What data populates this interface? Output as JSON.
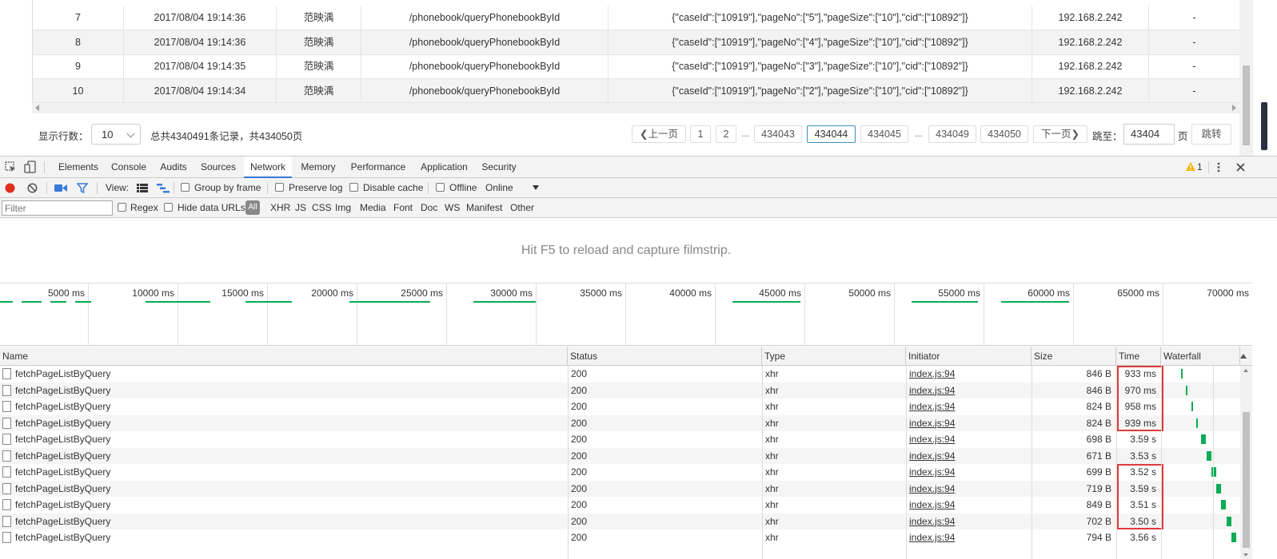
{
  "grid": {
    "rows": [
      {
        "no": "7",
        "time": "2017/08/04 19:14:36",
        "user": "范映渪",
        "url": "/phonebook/queryPhonebookById",
        "params": "{\"caseId\":[\"10919\"],\"pageNo\":[\"5\"],\"pageSize\":[\"10\"],\"cid\":[\"10892\"]}",
        "ip": "192.168.2.242",
        "extra": "-"
      },
      {
        "no": "8",
        "time": "2017/08/04 19:14:36",
        "user": "范映渪",
        "url": "/phonebook/queryPhonebookById",
        "params": "{\"caseId\":[\"10919\"],\"pageNo\":[\"4\"],\"pageSize\":[\"10\"],\"cid\":[\"10892\"]}",
        "ip": "192.168.2.242",
        "extra": "-"
      },
      {
        "no": "9",
        "time": "2017/08/04 19:14:35",
        "user": "范映渪",
        "url": "/phonebook/queryPhonebookById",
        "params": "{\"caseId\":[\"10919\"],\"pageNo\":[\"3\"],\"pageSize\":[\"10\"],\"cid\":[\"10892\"]}",
        "ip": "192.168.2.242",
        "extra": "-"
      },
      {
        "no": "10",
        "time": "2017/08/04 19:14:34",
        "user": "范映渪",
        "url": "/phonebook/queryPhonebookById",
        "params": "{\"caseId\":[\"10919\"],\"pageNo\":[\"2\"],\"pageSize\":[\"10\"],\"cid\":[\"10892\"]}",
        "ip": "192.168.2.242",
        "extra": "-"
      }
    ]
  },
  "pager": {
    "rows_label": "显示行数：",
    "rows_value": "10",
    "summary": "总共4340491条记录，共434050页",
    "prev": "上一页",
    "next": "下一页",
    "pages": [
      "1",
      "2",
      "434043",
      "434044",
      "434045",
      "434049",
      "434050"
    ],
    "ellipsis": "...",
    "current_page": "434044",
    "jump_label": "跳至：",
    "jump_value": "43404",
    "page_unit": "页",
    "jump_button": "跳转"
  },
  "devtools": {
    "tabs": [
      "Elements",
      "Console",
      "Audits",
      "Sources",
      "Network",
      "Memory",
      "Performance",
      "Application",
      "Security"
    ],
    "active_tab": "Network",
    "warning_count": "1",
    "toolbar": {
      "view_label": "View:",
      "group_by_frame": "Group by frame",
      "preserve_log": "Preserve log",
      "disable_cache": "Disable cache",
      "offline": "Offline",
      "throttle": "Online"
    },
    "filter": {
      "placeholder": "Filter",
      "regex": "Regex",
      "hide_data_urls": "Hide data URLs",
      "all": "All",
      "types": [
        "XHR",
        "JS",
        "CSS",
        "Img",
        "Media",
        "Font",
        "Doc",
        "WS",
        "Manifest",
        "Other"
      ]
    },
    "filmstrip_message": "Hit F5 to reload and capture filmstrip.",
    "overview": {
      "ticks": [
        "5000 ms",
        "10000 ms",
        "15000 ms",
        "20000 ms",
        "25000 ms",
        "30000 ms",
        "35000 ms",
        "40000 ms",
        "45000 ms",
        "50000 ms",
        "55000 ms",
        "60000 ms",
        "65000 ms",
        "70000 ms"
      ],
      "activity_ms": [
        [
          0,
          800
        ],
        [
          1300,
          2400
        ],
        [
          2900,
          3800
        ],
        [
          4300,
          5200
        ],
        [
          8200,
          11800
        ],
        [
          13800,
          16400
        ],
        [
          19600,
          24100
        ],
        [
          26500,
          30000
        ],
        [
          41000,
          44800
        ],
        [
          51000,
          54700
        ],
        [
          56000,
          59800
        ]
      ]
    },
    "columns": [
      "Name",
      "Status",
      "Type",
      "Initiator",
      "Size",
      "Time",
      "Waterfall"
    ],
    "requests": [
      {
        "name": "fetchPageListByQuery",
        "status": "200",
        "type": "xhr",
        "initiator": "index.js:94",
        "size": "846 B",
        "time": "933 ms"
      },
      {
        "name": "fetchPageListByQuery",
        "status": "200",
        "type": "xhr",
        "initiator": "index.js:94",
        "size": "846 B",
        "time": "970 ms"
      },
      {
        "name": "fetchPageListByQuery",
        "status": "200",
        "type": "xhr",
        "initiator": "index.js:94",
        "size": "824 B",
        "time": "958 ms"
      },
      {
        "name": "fetchPageListByQuery",
        "status": "200",
        "type": "xhr",
        "initiator": "index.js:94",
        "size": "824 B",
        "time": "939 ms"
      },
      {
        "name": "fetchPageListByQuery",
        "status": "200",
        "type": "xhr",
        "initiator": "index.js:94",
        "size": "698 B",
        "time": "3.59 s"
      },
      {
        "name": "fetchPageListByQuery",
        "status": "200",
        "type": "xhr",
        "initiator": "index.js:94",
        "size": "671 B",
        "time": "3.53 s"
      },
      {
        "name": "fetchPageListByQuery",
        "status": "200",
        "type": "xhr",
        "initiator": "index.js:94",
        "size": "699 B",
        "time": "3.52 s"
      },
      {
        "name": "fetchPageListByQuery",
        "status": "200",
        "type": "xhr",
        "initiator": "index.js:94",
        "size": "719 B",
        "time": "3.59 s"
      },
      {
        "name": "fetchPageListByQuery",
        "status": "200",
        "type": "xhr",
        "initiator": "index.js:94",
        "size": "849 B",
        "time": "3.51 s"
      },
      {
        "name": "fetchPageListByQuery",
        "status": "200",
        "type": "xhr",
        "initiator": "index.js:94",
        "size": "702 B",
        "time": "3.50 s"
      },
      {
        "name": "fetchPageListByQuery",
        "status": "200",
        "type": "xhr",
        "initiator": "index.js:94",
        "size": "794 B",
        "time": "3.56 s"
      }
    ],
    "highlighted_groups": [
      [
        0,
        3
      ],
      [
        6,
        9
      ]
    ],
    "icons": {
      "inspect": "inspect-element-icon",
      "device": "device-toolbar-icon",
      "record": "record-icon",
      "clear": "clear-icon",
      "capture": "capture-screenshots-icon",
      "filter": "filter-icon",
      "list_view": "large-rows-icon",
      "overview": "overview-icon",
      "warning": "warning-icon",
      "more": "kebab-menu-icon",
      "close": "close-icon"
    },
    "colors": {
      "record": "#e0301e",
      "accent": "#3879d9",
      "waterfall": "#0aab55",
      "highlight": "#e03a3a"
    }
  }
}
